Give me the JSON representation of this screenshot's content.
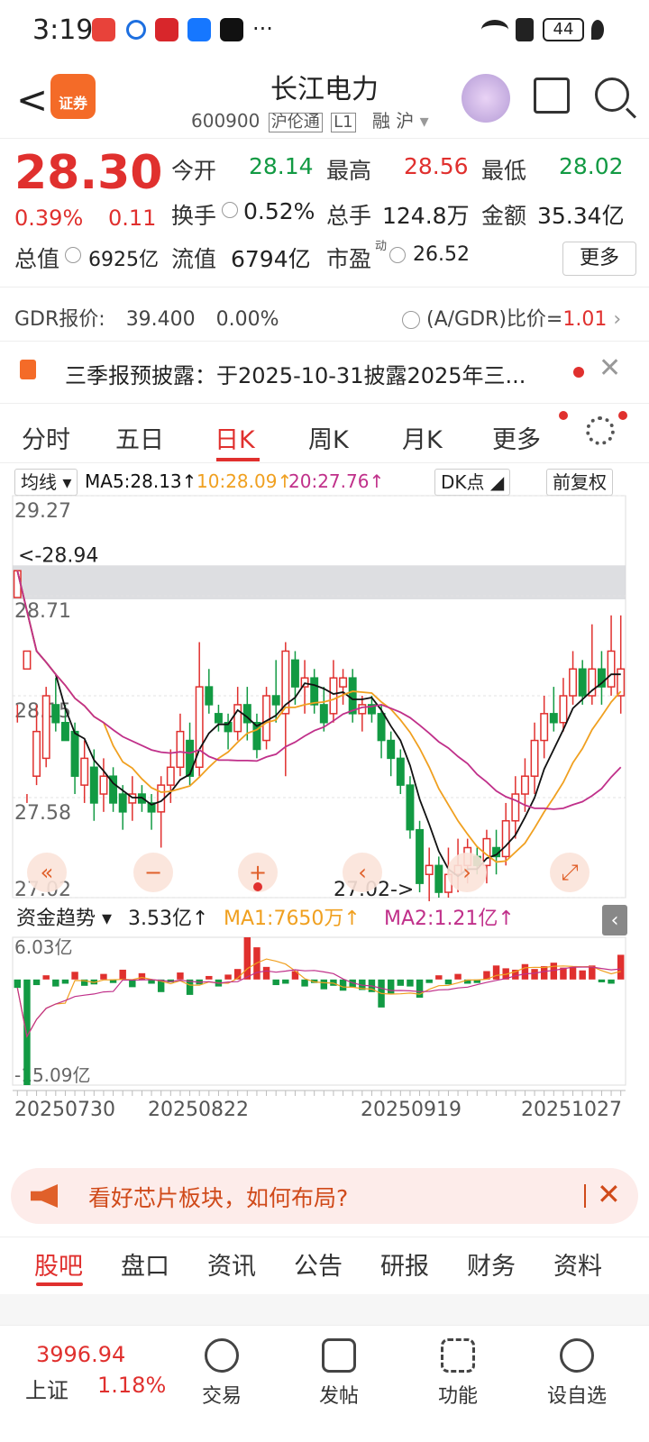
{
  "status": {
    "time": "3:19",
    "battery": "44",
    "more": "···"
  },
  "header": {
    "back_label": "<",
    "broker_badge": "证券",
    "stock_name": "长江电力",
    "stock_code": "600900",
    "tags": [
      "沪伦通",
      "L1",
      "融",
      "沪"
    ]
  },
  "quote": {
    "price": "28.30",
    "change_pct": "0.39%",
    "change_abs": "0.11",
    "open_label": "今开",
    "open": "28.14",
    "high_label": "最高",
    "high": "28.56",
    "low_label": "最低",
    "low": "28.02",
    "turnover_label": "换手",
    "turnover": "0.52%",
    "volume_label": "总手",
    "volume": "124.8万",
    "amount_label": "金额",
    "amount": "35.34亿",
    "mktcap_label": "总值",
    "mktcap": "6925亿",
    "float_label": "流值",
    "float": "6794亿",
    "pe_label": "市盈",
    "pe_sup": "动",
    "pe": "26.52",
    "more": "更多"
  },
  "gdr": {
    "label": "GDR报价:",
    "price": "39.400",
    "pct": "0.00%",
    "ratio_label": "(A/GDR)比价=",
    "ratio": "1.01"
  },
  "notice": {
    "text": "三季报预披露：于2025-10-31披露2025年三..."
  },
  "tabs": [
    {
      "label": "分时"
    },
    {
      "label": "五日"
    },
    {
      "label": "日K"
    },
    {
      "label": "周K"
    },
    {
      "label": "月K"
    },
    {
      "label": "更多"
    }
  ],
  "ma": {
    "selector": "均线",
    "ma5": "MA5:28.13↑",
    "ma10": "10:28.09↑",
    "ma20": "20:27.76↑",
    "dk": "DK点",
    "adjust": "前复权"
  },
  "colors": {
    "up": "#e0302e",
    "down": "#129a43",
    "ma5": "#111111",
    "ma10": "#f0a020",
    "ma20": "#c0308a"
  },
  "chart_data": [
    {
      "type": "candlestick",
      "title": "",
      "y_ticks": [
        "29.27",
        "28.71",
        "28.15",
        "27.58",
        "27.02"
      ],
      "ylim": [
        27.02,
        29.27
      ],
      "annotations": [
        "<-28.94",
        "27.02->"
      ],
      "candles": [
        [
          28.7,
          28.85,
          28.1,
          28.0
        ],
        [
          28.3,
          28.4,
          27.6,
          27.55
        ],
        [
          27.7,
          27.95,
          27.65,
          28.1
        ],
        [
          27.8,
          28.15,
          27.75,
          28.2
        ],
        [
          28.1,
          28.0,
          27.95,
          28.25
        ],
        [
          28.0,
          27.9,
          27.9,
          28.1
        ],
        [
          27.95,
          27.7,
          27.6,
          28.0
        ],
        [
          27.65,
          27.8,
          27.55,
          27.9
        ],
        [
          27.75,
          27.55,
          27.45,
          27.85
        ],
        [
          27.6,
          27.7,
          27.5,
          27.8
        ],
        [
          27.7,
          27.55,
          27.5,
          27.75
        ],
        [
          27.6,
          27.5,
          27.4,
          27.65
        ],
        [
          27.55,
          27.6,
          27.45,
          27.7
        ],
        [
          27.6,
          27.55,
          27.5,
          27.65
        ],
        [
          27.55,
          27.5,
          27.4,
          27.6
        ],
        [
          27.5,
          27.65,
          27.3,
          27.7
        ],
        [
          27.65,
          27.75,
          27.55,
          27.85
        ],
        [
          27.75,
          27.95,
          27.7,
          28.05
        ],
        [
          27.9,
          27.7,
          27.65,
          28.0
        ],
        [
          27.75,
          28.2,
          27.7,
          28.45
        ],
        [
          28.2,
          28.1,
          28.05,
          28.3
        ],
        [
          28.05,
          28.0,
          27.95,
          28.1
        ],
        [
          28.0,
          27.95,
          27.85,
          28.05
        ],
        [
          27.95,
          28.1,
          27.9,
          28.2
        ],
        [
          28.1,
          28.0,
          27.9,
          28.2
        ],
        [
          28.0,
          27.85,
          27.8,
          28.05
        ],
        [
          27.9,
          28.15,
          27.85,
          28.2
        ],
        [
          28.15,
          28.1,
          28.0,
          28.35
        ],
        [
          28.05,
          28.4,
          27.7,
          28.45
        ],
        [
          28.35,
          28.2,
          28.1,
          28.4
        ],
        [
          28.2,
          28.25,
          28.05,
          28.35
        ],
        [
          28.25,
          28.1,
          28.05,
          28.3
        ],
        [
          28.1,
          28.0,
          27.95,
          28.2
        ],
        [
          28.05,
          28.25,
          28.0,
          28.35
        ],
        [
          28.2,
          28.25,
          28.1,
          28.3
        ],
        [
          28.25,
          28.05,
          28.0,
          28.3
        ],
        [
          28.05,
          28.1,
          27.95,
          28.15
        ],
        [
          28.1,
          28.05,
          28.0,
          28.15
        ],
        [
          28.05,
          27.9,
          27.8,
          28.1
        ],
        [
          27.9,
          27.8,
          27.7,
          27.95
        ],
        [
          27.8,
          27.65,
          27.6,
          27.85
        ],
        [
          27.65,
          27.4,
          27.35,
          27.7
        ],
        [
          27.4,
          27.1,
          27.05,
          27.45
        ],
        [
          27.15,
          27.2,
          27.0,
          27.3
        ],
        [
          27.2,
          27.05,
          27.02,
          27.25
        ],
        [
          27.05,
          27.15,
          27.02,
          27.3
        ],
        [
          27.15,
          27.2,
          27.05,
          27.35
        ],
        [
          27.2,
          27.3,
          27.1,
          27.35
        ],
        [
          27.25,
          27.2,
          27.15,
          27.3
        ],
        [
          27.2,
          27.35,
          27.1,
          27.4
        ],
        [
          27.3,
          27.25,
          27.15,
          27.4
        ],
        [
          27.25,
          27.45,
          27.2,
          27.55
        ],
        [
          27.45,
          27.6,
          27.35,
          27.7
        ],
        [
          27.6,
          27.7,
          27.5,
          27.8
        ],
        [
          27.7,
          27.9,
          27.6,
          28.0
        ],
        [
          27.9,
          28.05,
          27.8,
          28.15
        ],
        [
          28.05,
          28.0,
          27.95,
          28.2
        ],
        [
          28.0,
          28.15,
          27.95,
          28.25
        ],
        [
          28.15,
          28.3,
          28.1,
          28.4
        ],
        [
          28.3,
          28.15,
          28.1,
          28.35
        ],
        [
          28.15,
          28.3,
          28.1,
          28.55
        ],
        [
          28.3,
          28.2,
          28.1,
          28.4
        ],
        [
          28.2,
          28.4,
          28.15,
          28.6
        ],
        [
          28.15,
          28.3,
          28.05,
          28.6
        ]
      ]
    },
    {
      "type": "bar",
      "title": "资金趋势",
      "values_label": "3.53亿↑",
      "ma1": "MA1:7650万↑",
      "ma2": "MA2:1.21亿↑",
      "y_ticks": [
        "6.03亿",
        "-15.09亿"
      ],
      "ylim": [
        -15.09,
        6.03
      ],
      "dates": [
        "20250730",
        "20250822",
        "20250919",
        "20251027"
      ],
      "values": [
        -1.2,
        -15.09,
        -0.8,
        0.6,
        -1.0,
        -0.6,
        1.1,
        -0.9,
        -0.7,
        0.8,
        -0.5,
        1.4,
        -1.1,
        0.9,
        -0.6,
        -1.8,
        -0.4,
        1.0,
        -2.2,
        -0.7,
        0.5,
        -1.0,
        0.7,
        1.5,
        6.03,
        4.6,
        1.8,
        -0.8,
        -0.6,
        1.2,
        -1.0,
        -0.5,
        -1.4,
        -0.9,
        -1.6,
        -1.1,
        -1.5,
        -1.8,
        -4.0,
        -2.0,
        -0.9,
        -1.0,
        -2.6,
        -0.5,
        0.6,
        -0.7,
        0.8,
        -0.6,
        -0.5,
        1.2,
        2.0,
        1.6,
        1.4,
        2.2,
        1.5,
        1.9,
        2.4,
        1.7,
        1.8,
        1.3,
        2.0,
        -0.4,
        -0.6,
        3.53
      ]
    }
  ],
  "banner": {
    "text": "看好芯片板块，如何布局?"
  },
  "bottom_tabs": [
    {
      "label": "股吧"
    },
    {
      "label": "盘口"
    },
    {
      "label": "资讯"
    },
    {
      "label": "公告"
    },
    {
      "label": "研报"
    },
    {
      "label": "财务"
    },
    {
      "label": "资料"
    }
  ],
  "navbar": {
    "index_value": "3996.94",
    "index_name": "上证",
    "index_pct": "1.18%",
    "items": [
      {
        "label": "交易"
      },
      {
        "label": "发帖"
      },
      {
        "label": "功能"
      },
      {
        "label": "设自选"
      }
    ]
  }
}
